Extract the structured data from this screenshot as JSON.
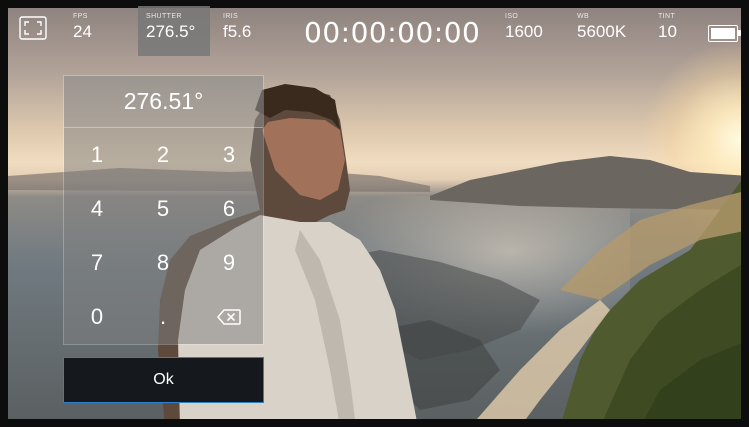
{
  "status_bar": {
    "fps": {
      "label": "FPS",
      "value": "24"
    },
    "shutter": {
      "label": "SHUTTER",
      "value": "276.5°"
    },
    "iris": {
      "label": "IRIS",
      "value": "f5.6"
    },
    "timecode": "00:00:00:00",
    "iso": {
      "label": "ISO",
      "value": "1600"
    },
    "wb": {
      "label": "WB",
      "value": "5600K"
    },
    "tint": {
      "label": "TINT",
      "value": "10"
    }
  },
  "icons": {
    "fullscreen": "fullscreen-icon",
    "battery": "battery-icon",
    "backspace": "backspace-icon"
  },
  "keypad": {
    "display_value": "276.51°",
    "keys": [
      "1",
      "2",
      "3",
      "4",
      "5",
      "6",
      "7",
      "8",
      "9",
      "0",
      "."
    ]
  },
  "ok_button": {
    "label": "Ok"
  },
  "colors": {
    "active_param_bg": "#787878",
    "ok_border": "#2d7fd0",
    "ok_bg": "#15181c"
  }
}
